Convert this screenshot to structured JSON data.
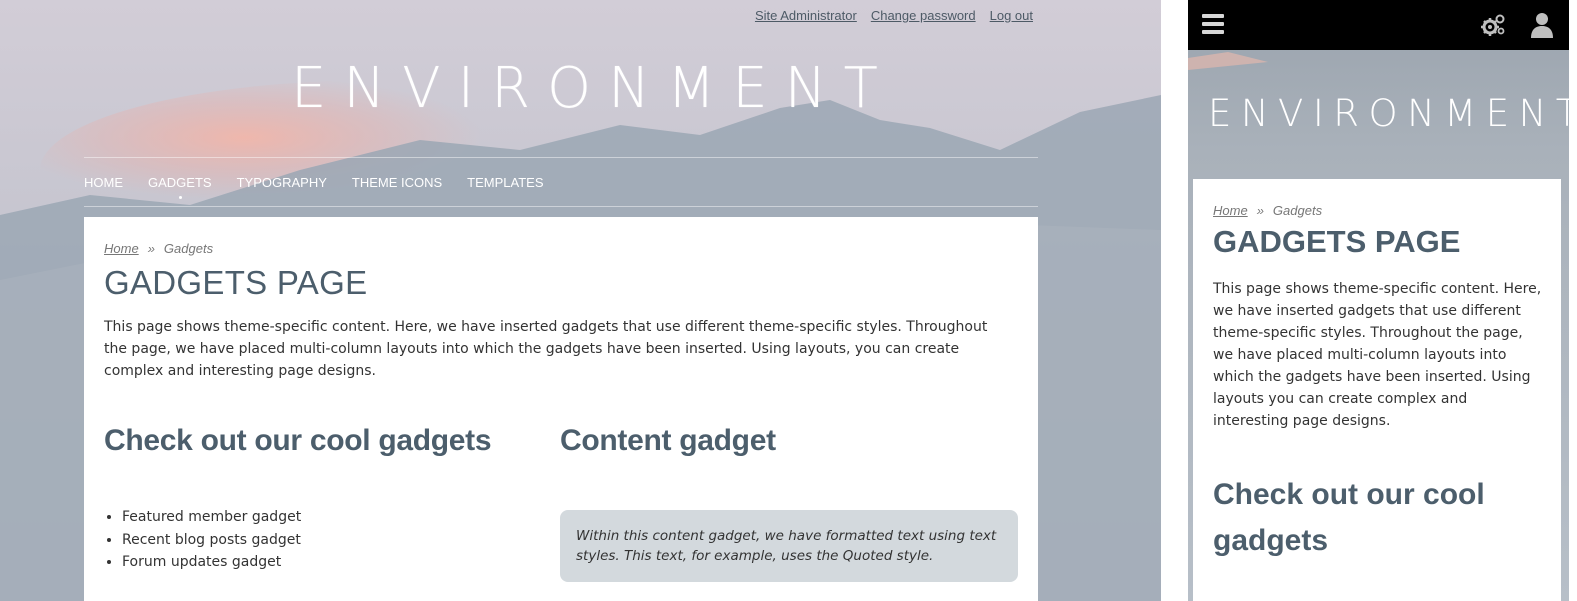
{
  "colors": {
    "heading": "#4c5e6c",
    "quote_bg": "#d3d9dd",
    "mobile_bar": "#000000",
    "sky_top": "#cfcbd6",
    "mountain": "#9aa6b3"
  },
  "utility_nav": [
    "Site Administrator",
    "Change password",
    "Log out"
  ],
  "site": {
    "title": "ENVIRONMENT"
  },
  "nav": {
    "items": [
      "HOME",
      "GADGETS",
      "TYPOGRAPHY",
      "THEME ICONS",
      "TEMPLATES"
    ],
    "active": "GADGETS"
  },
  "breadcrumb": {
    "home": "Home",
    "separator": "»",
    "current": "Gadgets"
  },
  "page": {
    "title": "GADGETS PAGE",
    "intro": "This page shows theme-specific content. Here, we have inserted gadgets that use different theme-specific styles. Throughout the page, we have placed multi-column layouts into which the gadgets have been inserted. Using layouts, you can create complex and interesting page designs.",
    "intro_mobile": "This page shows theme-specific content. Here, we have inserted gadgets that use different theme-specific styles. Throughout the page, we have placed multi-column layouts into which the gadgets have been inserted. Using layouts you can create complex and interesting page designs."
  },
  "gadgets_column": {
    "title": "Check out our cool gadgets",
    "items": [
      "Featured member gadget",
      "Recent blog posts gadget",
      "Forum updates gadget"
    ]
  },
  "content_gadget": {
    "title": "Content gadget",
    "quote": "Within this content gadget, we have formatted text using text styles. This text, for example, uses the Quoted style."
  },
  "mobile": {
    "icons": [
      "menu-icon",
      "gear-icon",
      "user-icon"
    ]
  }
}
